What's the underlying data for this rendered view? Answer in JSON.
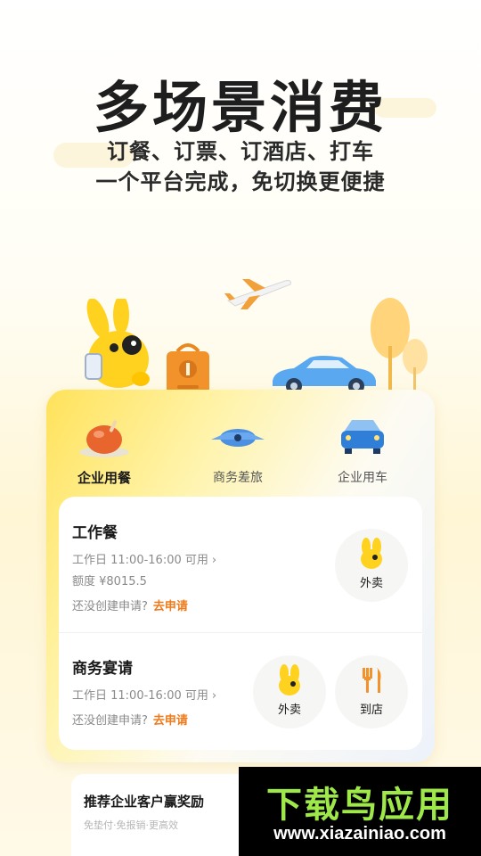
{
  "hero": {
    "headline": "多场景消费",
    "line1": "订餐、订票、订酒店、打车",
    "line2": "一个平台完成，免切换更便捷"
  },
  "tabs": [
    {
      "label": "企业用餐",
      "icon": "chicken-icon",
      "active": true
    },
    {
      "label": "商务差旅",
      "icon": "airplane-icon",
      "active": false
    },
    {
      "label": "企业用车",
      "icon": "car-icon",
      "active": false
    }
  ],
  "work_meal": {
    "title": "工作餐",
    "hours": "工作日 11:00-16:00 可用",
    "quota": "额度 ¥8015.5",
    "apply_prompt": "还没创建申请?",
    "apply_link": "去申请",
    "takeout_label": "外卖"
  },
  "business_banquet": {
    "title": "商务宴请",
    "hours": "工作日 11:00-16:00 可用",
    "apply_prompt": "还没创建申请?",
    "apply_link": "去申请",
    "takeout_label": "外卖",
    "dinein_label": "到店"
  },
  "promo": {
    "title": "推荐企业客户赢奖励",
    "subtitle": "免垫付·免报销·更高效"
  },
  "watermark": {
    "brand": "下载鸟应用",
    "url": "www.xiazainiao.com"
  },
  "colors": {
    "accent": "#ffd93b",
    "link": "#f07a1a"
  }
}
